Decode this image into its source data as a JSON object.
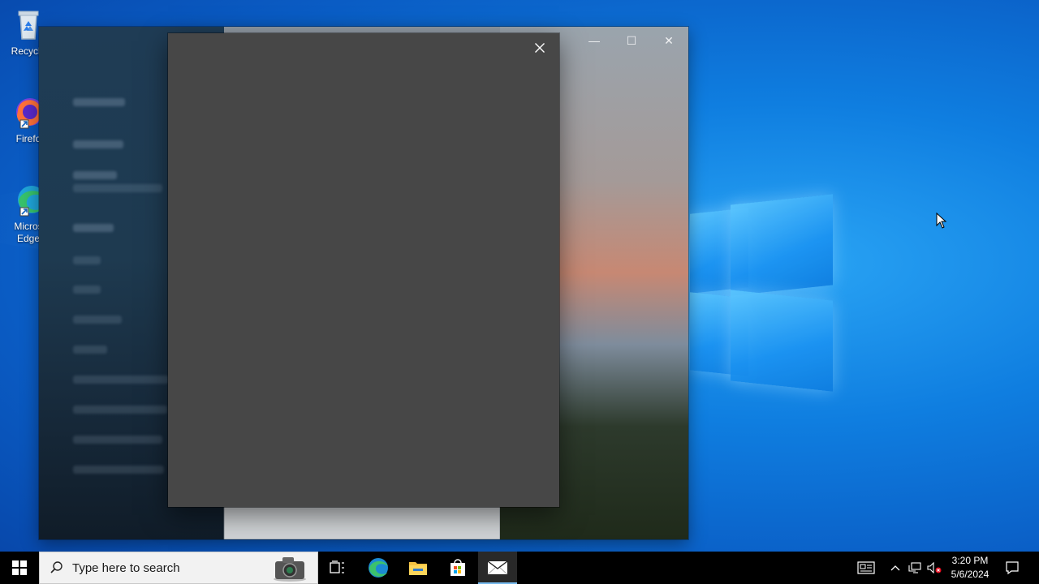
{
  "desktop": {
    "icons": [
      {
        "label": "Recycle",
        "icon": "recycle-bin-icon"
      },
      {
        "label": "Firefo",
        "icon": "firefox-icon"
      },
      {
        "label": "Micros\nEdge",
        "icon": "edge-icon"
      }
    ]
  },
  "mail_window": {
    "title_controls": [
      "minimize",
      "maximize",
      "close"
    ]
  },
  "dialog": {
    "close_icon": "close-icon"
  },
  "taskbar": {
    "search_placeholder": "Type here to search",
    "apps": [
      "task-view-icon",
      "edge-icon",
      "file-explorer-icon",
      "store-icon",
      "mail-icon"
    ],
    "active_app": "mail-icon",
    "clock": {
      "time": "3:20 PM",
      "date": "5/6/2024"
    }
  },
  "colors": {
    "taskbar": "#000000",
    "dialog": "#474747",
    "accent": "#76b9ed"
  }
}
